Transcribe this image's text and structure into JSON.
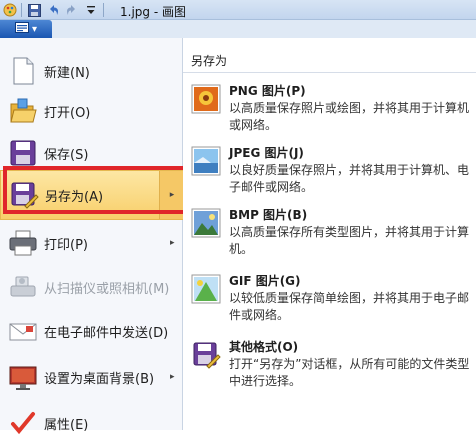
{
  "titlebar": {
    "title": "1.jpg - 画图",
    "quick_access": [
      "paint-app-icon",
      "save-icon",
      "undo-icon",
      "redo-icon",
      "customize-icon"
    ]
  },
  "file_menu_button": {
    "icon": "file-menu-icon",
    "caret": "▾"
  },
  "left_menu": {
    "items": [
      {
        "label": "新建(N)",
        "icon": "new-document-icon",
        "has_arrow": false,
        "disabled": false,
        "active": false
      },
      {
        "label": "打开(O)",
        "icon": "open-folder-icon",
        "has_arrow": false,
        "disabled": false,
        "active": false
      },
      {
        "label": "保存(S)",
        "icon": "save-disk-icon",
        "has_arrow": false,
        "disabled": false,
        "active": false
      },
      {
        "label": "另存为(A)",
        "icon": "save-as-icon",
        "has_arrow": true,
        "disabled": false,
        "active": true
      },
      {
        "label": "打印(P)",
        "icon": "printer-icon",
        "has_arrow": true,
        "disabled": false,
        "active": false
      },
      {
        "label": "从扫描仪或照相机(M)",
        "icon": "scanner-icon",
        "has_arrow": false,
        "disabled": true,
        "active": false
      },
      {
        "label": "在电子邮件中发送(D)",
        "icon": "email-icon",
        "has_arrow": false,
        "disabled": false,
        "active": false
      },
      {
        "label": "设置为桌面背景(B)",
        "icon": "desktop-background-icon",
        "has_arrow": true,
        "disabled": false,
        "active": false
      },
      {
        "label": "属性(E)",
        "icon": "properties-icon",
        "has_arrow": false,
        "disabled": false,
        "active": false
      }
    ],
    "arrow_glyph": "▸"
  },
  "save_as_panel": {
    "title": "另存为",
    "options": [
      {
        "title": "PNG 图片(P)",
        "desc": "以高质量保存照片或绘图，并将其用于计算机或网络。",
        "icon": "png-image-icon"
      },
      {
        "title": "JPEG 图片(J)",
        "desc": "以良好质量保存照片，并将其用于计算机、电子邮件或网络。",
        "icon": "jpeg-image-icon"
      },
      {
        "title": "BMP 图片(B)",
        "desc": "以高质量保存所有类型图片，并将其用于计算机。",
        "icon": "bmp-image-icon"
      },
      {
        "title": "GIF 图片(G)",
        "desc": "以较低质量保存简单绘图，并将其用于电子邮件或网络。",
        "icon": "gif-image-icon"
      },
      {
        "title": "其他格式(O)",
        "desc": "打开“另存为”对话框，从所有可能的文件类型中进行选择。",
        "icon": "other-formats-icon"
      }
    ]
  },
  "colors": {
    "highlight_border": "#e0262a",
    "active_item": "#f8cf6a",
    "file_button": "#1a56b1"
  }
}
